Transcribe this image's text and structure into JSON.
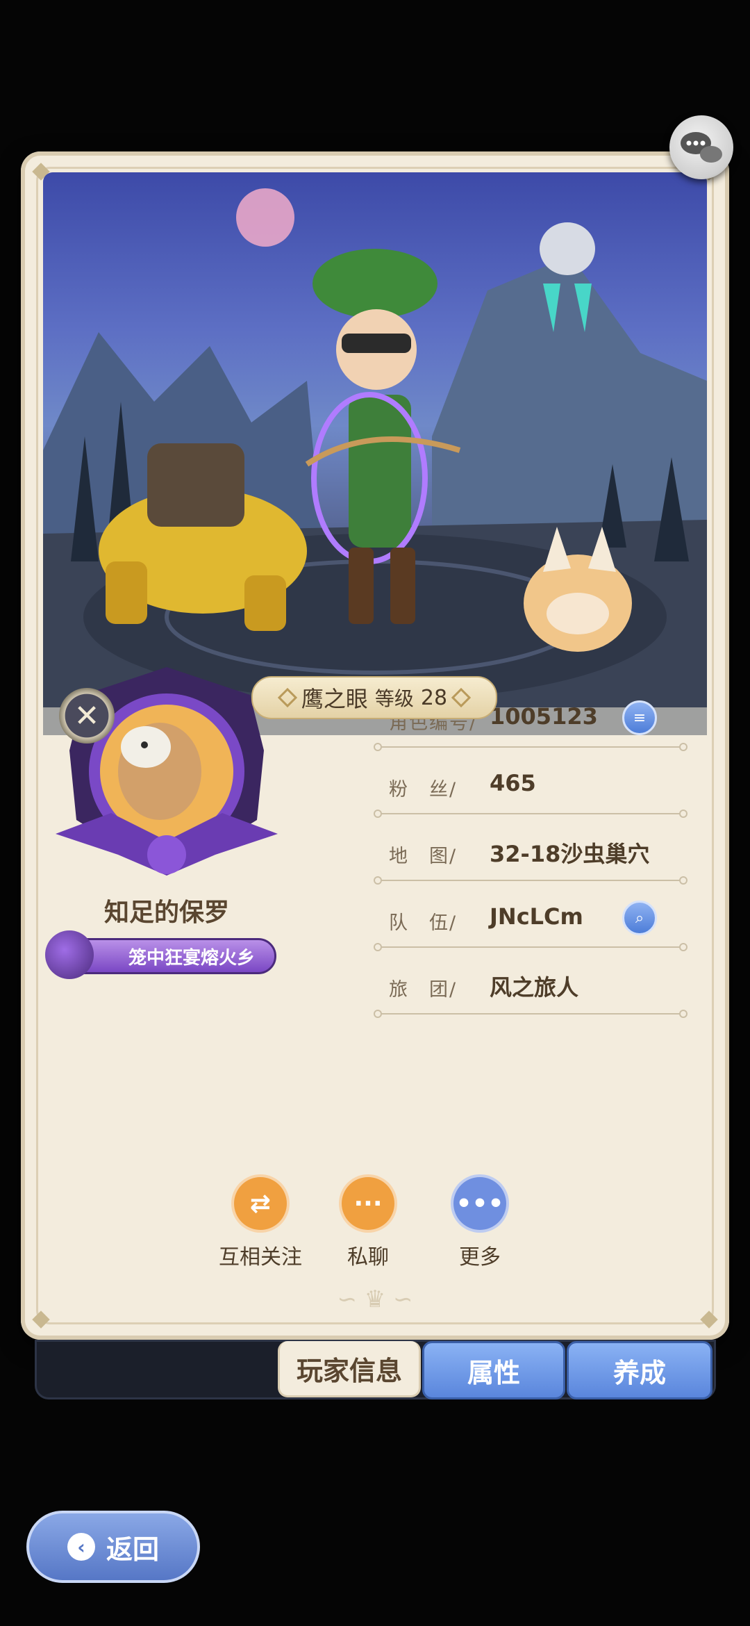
{
  "hero": {
    "name": "鹰之眼",
    "level_label": "等级",
    "level": "28"
  },
  "player": {
    "name": "知足的保罗",
    "title": "笼中狂宴熔火乡"
  },
  "info_rows": [
    {
      "label": "角色编号/",
      "value": "1005123"
    },
    {
      "label": "粉　丝/",
      "value": "465"
    },
    {
      "label": "地　图/",
      "value": "32-18沙虫巢穴"
    },
    {
      "label": "队　伍/",
      "value": "JNcLCm"
    },
    {
      "label": "旅　团/",
      "value": "风之旅人"
    }
  ],
  "actions": {
    "follow": "互相关注",
    "chat": "私聊",
    "more": "更多"
  },
  "tabs": {
    "player_info": "玩家信息",
    "attributes": "属性",
    "develop": "养成"
  },
  "back_label": "返回",
  "colors": {
    "follow": "#f0a040",
    "chat": "#f0a040",
    "more": "#6f8fe0",
    "tab_blue": "#6a94e4"
  }
}
